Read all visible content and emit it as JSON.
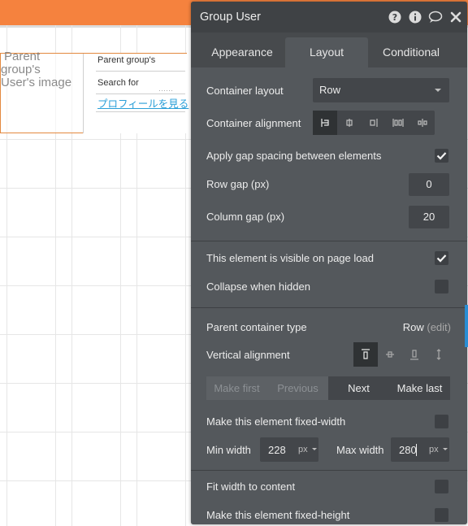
{
  "canvas": {
    "image_placeholder": [
      "Parent",
      "group's",
      "User's image"
    ],
    "parent_group_text": "Parent group's",
    "search_for_text": "Search for",
    "profile_link": "プロフィールを見る",
    "dots": "⋯⋯"
  },
  "panel": {
    "title": "Group User",
    "icons": [
      "help-icon",
      "info-icon",
      "comment-icon",
      "close-icon"
    ],
    "tabs": [
      "Appearance",
      "Layout",
      "Conditional"
    ],
    "active_tab": "Layout",
    "container_layout": {
      "label": "Container layout",
      "value": "Row"
    },
    "container_alignment": {
      "label": "Container alignment",
      "options": [
        "align-left",
        "align-center",
        "align-right",
        "space-between",
        "space-around"
      ],
      "selected": 0
    },
    "apply_gap": {
      "label": "Apply gap spacing between elements",
      "checked": true
    },
    "row_gap": {
      "label": "Row gap (px)",
      "value": "0"
    },
    "column_gap": {
      "label": "Column gap (px)",
      "value": "20"
    },
    "visible_on_load": {
      "label": "This element is visible on page load",
      "checked": true
    },
    "collapse_hidden": {
      "label": "Collapse when hidden",
      "checked": false
    },
    "parent_container_type": {
      "label": "Parent container type",
      "value": "Row",
      "edit": "(edit)"
    },
    "vertical_alignment": {
      "label": "Vertical alignment",
      "options": [
        "top",
        "center",
        "bottom",
        "stretch"
      ],
      "selected": 0
    },
    "order_buttons": [
      "Make first",
      "Previous",
      "Next",
      "Make last"
    ],
    "fixed_width": {
      "label": "Make this element fixed-width",
      "checked": false
    },
    "min_width": {
      "label": "Min width",
      "value": "228",
      "unit": "px"
    },
    "max_width": {
      "label": "Max width",
      "value": "280",
      "unit": "px"
    },
    "fit_width": {
      "label": "Fit width to content",
      "checked": false
    },
    "fixed_height": {
      "label": "Make this element fixed-height",
      "checked": false
    }
  },
  "colors": {
    "accent_orange": "#f5823e",
    "panel_bg": "#54585c",
    "panel_header": "#3f4245",
    "link_blue": "#2a9fd8"
  }
}
